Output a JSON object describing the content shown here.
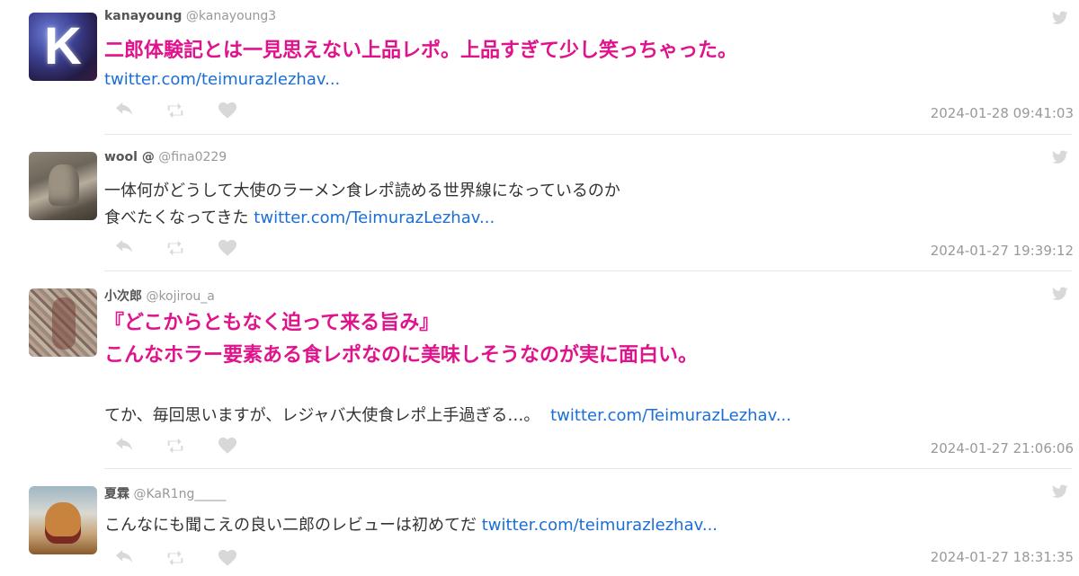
{
  "colors": {
    "accent": "#e0138c",
    "link": "#1b6ed4",
    "muted": "#999999",
    "icon": "#d8d8d8"
  },
  "tweets": [
    {
      "name": "kanayoung",
      "handle": "@kanayoung3",
      "avatar_letter": "K",
      "line1": "二郎体験記とは一見思えない上品レポ。上品すぎて少し笑っちゃった。",
      "link": "twitter.com/teimurazlezhav...",
      "time": "2024-01-28 09:41:03"
    },
    {
      "name": "wool @",
      "handle": "@fina0229",
      "line1": "一体何がどうして大使のラーメン食レポ読める世界線になっているのか",
      "line2": "食べたくなってきた",
      "link": "twitter.com/TeimurazLezhav...",
      "time": "2024-01-27 19:39:12"
    },
    {
      "name": "小次郎",
      "handle": "@kojirou_a",
      "line1": "『どこからともなく迫って来る旨み』",
      "line2": "こんなホラー要素ある食レポなのに美味しそうなのが実に面白い。",
      "line3": "てか、毎回思いますが、レジャバ大使食レポ上手過ぎる…。",
      "link": "twitter.com/TeimurazLezhav...",
      "time": "2024-01-27 21:06:06"
    },
    {
      "name": "夏霖",
      "handle": "@KaR1ng_____",
      "line1": "こんなにも聞こえの良い二郎のレビューは初めてだ",
      "link": "twitter.com/teimurazlezhav...",
      "time": "2024-01-27 18:31:35"
    }
  ],
  "icons": [
    "reply-icon",
    "retweet-icon",
    "like-icon",
    "twitter-bird-icon"
  ]
}
